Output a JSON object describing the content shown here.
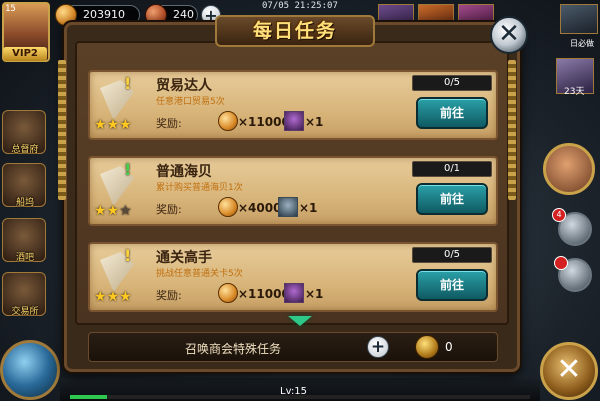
{
  "hud": {
    "player_level": "15",
    "vip": "VIP2",
    "coins": "203910",
    "shells": "240",
    "plus": "+",
    "clock": "07/05 21:25:07",
    "ext_label": "日必做",
    "ext_days": "23天",
    "mail_badge": "4",
    "lv_text": "Lv:15",
    "xp_fraction": 0.08
  },
  "side_menu": [
    "总督府",
    "船坞",
    "酒吧",
    "交易所"
  ],
  "dialog": {
    "title": "每日任务",
    "close": "✕",
    "tasks": [
      {
        "name": "贸易达人",
        "desc": "任意港口贸易5次",
        "reward_label": "奖励:",
        "coin_amount": "×11000",
        "item_qty": "×1",
        "progress": "0/5",
        "button": "前往",
        "stars": 3,
        "mark": "!",
        "mark_color": "#ffd23a"
      },
      {
        "name": "普通海贝",
        "desc": "累计购买普通海贝1次",
        "reward_label": "奖励:",
        "coin_amount": "×4000",
        "item_qty": "×1",
        "progress": "0/1",
        "button": "前往",
        "stars": 2,
        "mark": "!",
        "mark_color": "#4ad04a"
      },
      {
        "name": "通关高手",
        "desc": "挑战任意普通关卡5次",
        "reward_label": "奖励:",
        "coin_amount": "×11000",
        "item_qty": "×1",
        "progress": "0/5",
        "button": "前往",
        "stars": 3,
        "mark": "!",
        "mark_color": "#ffd23a"
      }
    ],
    "footer": {
      "text": "召唤商会特殊任务",
      "plus": "+",
      "count": "0"
    }
  }
}
